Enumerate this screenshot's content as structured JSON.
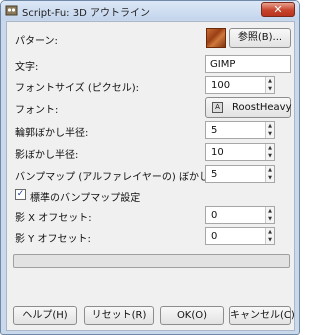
{
  "window": {
    "title": "Script-Fu: 3D アウトライン",
    "close_glyph": "✕"
  },
  "fields": {
    "pattern": {
      "label": "パターン:",
      "button_label": "参照(B)..."
    },
    "text": {
      "label": "文字:",
      "value": "GIMP"
    },
    "font_size": {
      "label": "フォントサイズ (ピクセル):",
      "value": "100"
    },
    "font": {
      "label": "フォント:",
      "value": "RoostHeavy",
      "icon_glyph": "A"
    },
    "outline_blur": {
      "label": "輪郭ぼかし半径:",
      "value": "5"
    },
    "shadow_blur": {
      "label": "影ぼかし半径:",
      "value": "10"
    },
    "bumpmap_blur": {
      "label": "バンプマップ (アルファレイヤーの) ぼかし半径:",
      "value": "5"
    },
    "default_bumpmap": {
      "label": "標準のバンプマップ設定",
      "checked": true,
      "check_glyph": "✓"
    },
    "shadow_x": {
      "label": "影 X オフセット:",
      "value": "0"
    },
    "shadow_y": {
      "label": "影 Y オフセット:",
      "value": "0"
    }
  },
  "spin_glyphs": {
    "up": "▲",
    "down": "▼"
  },
  "progress": {
    "fraction": 0
  },
  "footer": {
    "help": "ヘルプ(H)",
    "reset": "リセット(R)",
    "ok": "OK(O)",
    "cancel": "キャンセル(C)"
  },
  "colors": {
    "window_frame": "#c9d8ea",
    "close_button": "#c7432c",
    "pattern_swatch": "#b55a25"
  }
}
